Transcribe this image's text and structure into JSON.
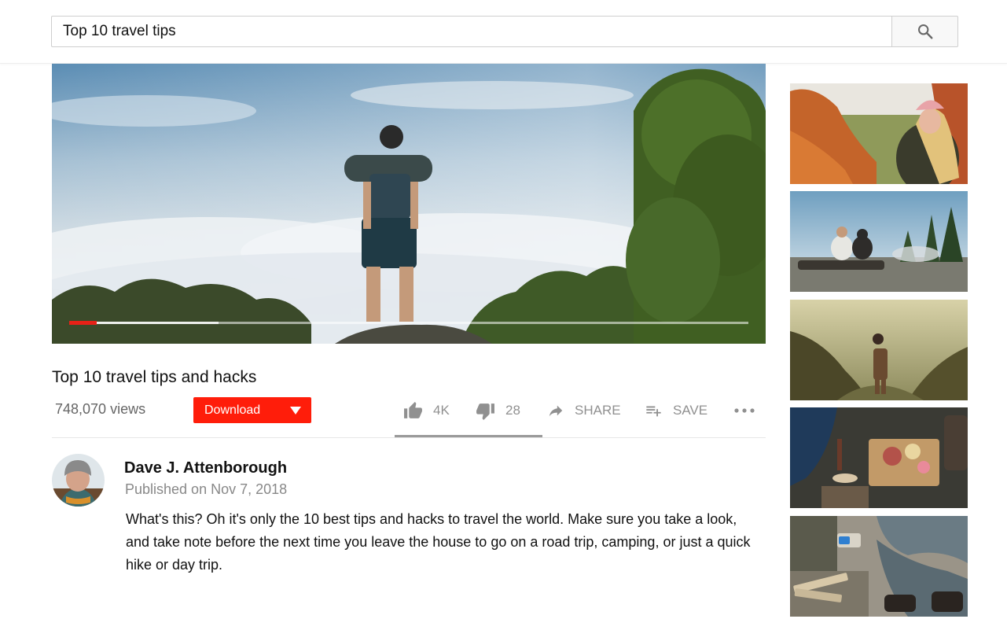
{
  "search": {
    "query": "Top 10 travel tips"
  },
  "video": {
    "progress_played_fraction": 0.04,
    "progress_buffered_fraction": 0.22,
    "title": "Top 10 travel tips and hacks",
    "views": "748,070 views",
    "download_label": "Download",
    "likes": "4K",
    "dislikes": "28",
    "share_label": "SHARE",
    "save_label": "SAVE",
    "like_ratio_fraction": 1.0
  },
  "channel": {
    "name": "Dave J. Attenborough",
    "published": "Published on Nov 7, 2018"
  },
  "description": "What's this? Oh it's only the 10 best tips and hacks to travel the world. Make sure you take a look, and take note before the next time you leave the house to go on a road trip, camping, or just a quick hike or day trip.",
  "colors": {
    "accent_red": "#ff1d0a",
    "progress_red": "#e62117",
    "icon_gray": "#909090"
  },
  "icons": {
    "search": "search-icon",
    "like": "thumbs-up-icon",
    "dislike": "thumbs-down-icon",
    "share": "share-arrow-icon",
    "save": "playlist-add-icon",
    "more": "more-horizontal-icon",
    "download_menu": "caret-down-icon"
  },
  "sidebar": {
    "thumbnails": [
      {
        "name": "thumbnail-1"
      },
      {
        "name": "thumbnail-2"
      },
      {
        "name": "thumbnail-3"
      },
      {
        "name": "thumbnail-4"
      },
      {
        "name": "thumbnail-5"
      }
    ]
  }
}
